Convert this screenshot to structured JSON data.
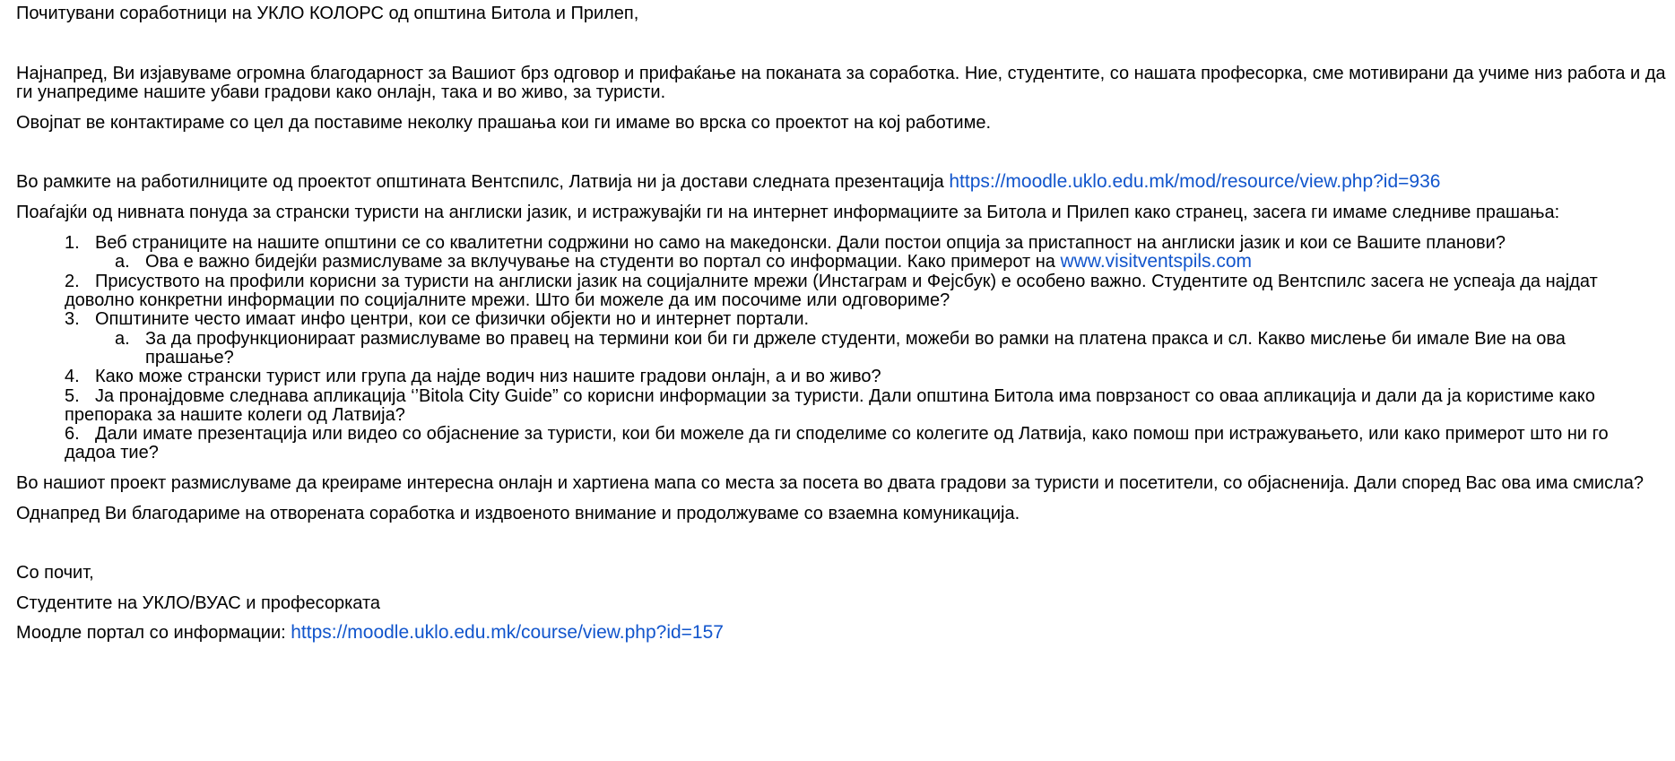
{
  "letter": {
    "greeting": "Почитувани соработници на УКЛО КОЛОРС од општина Битола и Прилеп,",
    "intro_line1": "Најнапред, Ви изјавуваме огромна благодарност за Вашиот брз одговор и прифаќање на поканата за соработка. Ние, студентите, со нашата професорка, сме мотивирани да учиме низ работа и да",
    "intro_line2": "ги унапредиме нашите убави градови како онлајн, така и во живо, за туристи.",
    "purpose": "Овојпат ве контактираме со цел да поставиме неколку прашања кои ги имаме во врска со проектот на кој работиме.",
    "presentation_text": "Во рамките на работилниците од проектот општината Вентспилс, Латвија ни ја достави следната презентација",
    "presentation_link": "https://moodle.uklo.edu.mk/mod/resource/view.php?id=936",
    "questions_intro": "Поаѓајќи од нивната понуда за странски туристи на англиски јазик, и истражувајќи ги на интернет информациите за Битола и Прилеп како странец, засега ги имаме следниве прашања:",
    "items": {
      "n1": "1.",
      "q1": "Веб страниците на нашите општини се со квалитетни содржини но само на македонски. Дали постои опција за пристапност на англиски јазик и кои се Вашите планови?",
      "a1": "a.",
      "q1a": "Ова е важно бидејќи размислуваме за вклучување на студенти во портал со информации. Како примерот на",
      "q1a_link": "www.visitventspils.com",
      "n2": "2.",
      "q2_line1": "Присуството на профили корисни за туристи на англиски јазик на социјалните мрежи (Инстаграм и Фејсбук) е особено важно. Студентите од Вентспилс засега не успеаја да најдат",
      "q2_line2": "доволно конкретни информации по социјалните мрежи. Што би можеле да им посочиме или одговориме?",
      "n3": "3.",
      "q3": "Општините често имаат инфо центри, кои се физички објекти но и интернет портали.",
      "a3": "a.",
      "q3a_line1": "За да профункционираат размислуваме во правец на термини кои би ги држеле студенти, можеби во рамки на платена пракса и сл. Какво мислење би имале Вие на ова",
      "q3a_line2": "прашање?",
      "n4": "4.",
      "q4": "Како може странски турист или група да најде водич низ нашите градови онлајн, а и во живо?",
      "n5": "5.",
      "q5_line1": "Ја пронајдовме следнава апликација ‘’Bitola City Guide” со корисни информации за туристи. Дали општина Битола има поврзаност со оваа апликација и дали да ја користиме како",
      "q5_line2": "препорака за нашите колеги од Латвија?",
      "n6": "6.",
      "q6_line1": "Дали имате презентација или видео со објаснение за туристи, кои би можеле да ги споделиме со колегите од Латвија, како помош при истражувањето, или како примерот што ни го",
      "q6_line2": "дадоа тие?"
    },
    "map_idea": "Во нашиот проект размислуваме да креираме интересна онлајн и хартиена мапа со места за посета во двата градови за туристи и посетители, со објасненија. Дали според Вас ова има смисла?",
    "thanks": "Однапред Ви благодариме на отворената соработка и издвоеното внимание и продолжуваме со взаемна комуникација.",
    "closing": "Со почит,",
    "signature": "Студентите на УКЛО/ВУАС и професорката",
    "portal_label": "Моодле портал со информации:",
    "portal_link": "https://moodle.uklo.edu.mk/course/view.php?id=157"
  },
  "colors": {
    "link": "#1155cc",
    "text": "#000000",
    "background": "#ffffff"
  }
}
